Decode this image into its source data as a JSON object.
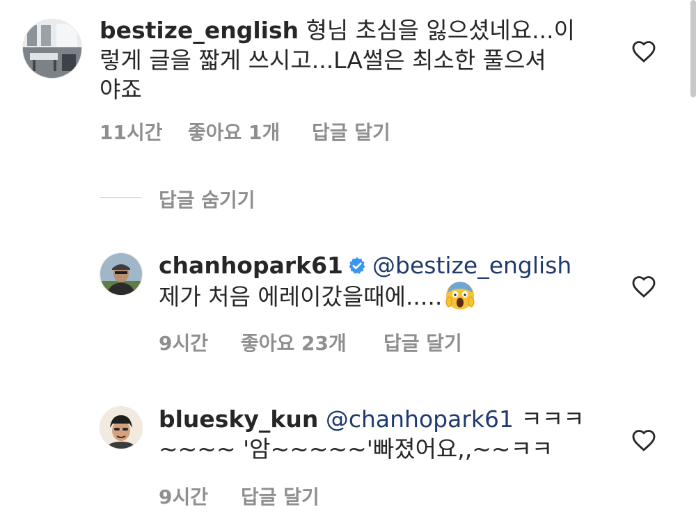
{
  "comments": [
    {
      "username": "bestize_english",
      "text_line1": " 형님 초심을 잃으셨네요...이",
      "text_line2": "렇게 글을 짧게 쓰시고...LA썰은 최소한 풀으셔",
      "text_line3": "야죠",
      "time": "11시간",
      "likes": "좋아요 1개",
      "reply": "답글 달기"
    },
    {
      "username": "chanhopark61",
      "mention": "@bestize_english",
      "text_line2": "제가 처음 에레이갔을때에.....",
      "emoji": "face-screaming-in-fear",
      "time": "9시간",
      "likes": "좋아요 23개",
      "reply": "답글 달기"
    },
    {
      "username": "bluesky_kun",
      "mention": "@chanhopark61",
      "text_line1_tail": " ㅋㅋㅋ",
      "text_line2": "~~~~ '암~~~~~'빠졌어요,,~~ㅋㅋ",
      "time": "9시간",
      "reply": "답글 달기"
    }
  ],
  "hide_replies": "답글 숨기기",
  "icons": {
    "heart": "heart-outline-icon",
    "verified": "verified-badge-icon"
  },
  "colors": {
    "text": "#262626",
    "meta": "#8e8e8e",
    "mention": "#1f3a6e",
    "verified": "#3897f0"
  }
}
